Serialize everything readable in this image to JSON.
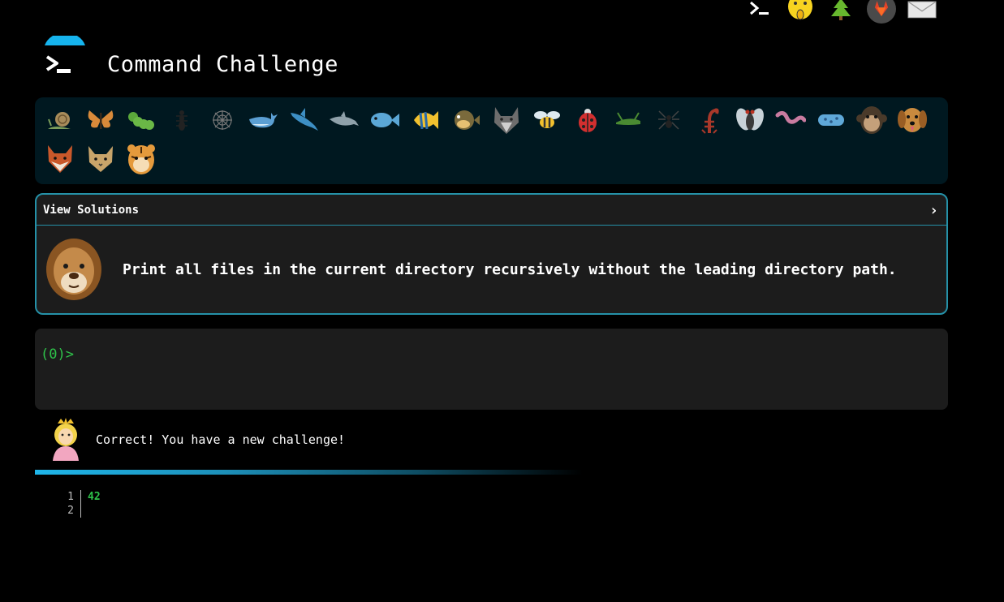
{
  "header": {
    "title": "Command Challenge",
    "logo_icon": "terminal-prompt-icon",
    "accent_color": "#16b4ee"
  },
  "top_bar": {
    "icons": [
      "terminal-icon",
      "shushing-face-icon",
      "tree-icon",
      "gitlab-icon",
      "mail-icon"
    ]
  },
  "animals": {
    "completed": [
      "snail",
      "butterfly",
      "caterpillar",
      "ant",
      "spider-web",
      "whale",
      "shark",
      "dolphin",
      "fish",
      "tropical-fish",
      "blowfish",
      "wolf",
      "bee",
      "ladybug",
      "cricket",
      "spider",
      "scorpion",
      "fly",
      "worm",
      "microbe",
      "monkey",
      "dog",
      "fox",
      "cat",
      "tiger"
    ]
  },
  "solutions": {
    "header_label": "View Solutions",
    "chevron": "›",
    "avatar_icon": "lion-icon",
    "challenge_text": "Print all files in the current directory recursively without the leading directory path."
  },
  "terminal": {
    "prompt": "(0)>"
  },
  "status": {
    "icon": "princess-icon",
    "message": "Correct! You have a new challenge!",
    "progress": 0.6
  },
  "output": {
    "lines": [
      {
        "num": "1",
        "text": "42"
      },
      {
        "num": "2",
        "text": ""
      }
    ]
  }
}
